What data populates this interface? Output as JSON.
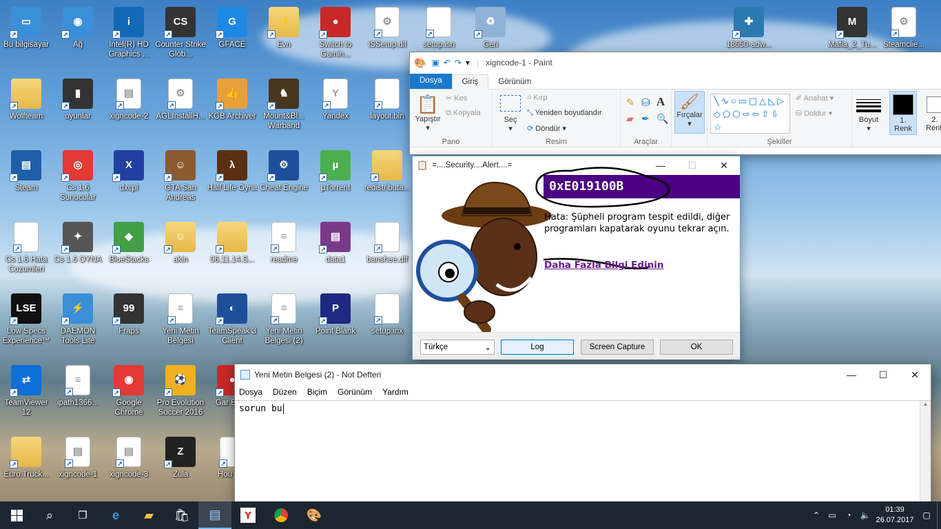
{
  "desktop": {
    "icons": [
      {
        "label": "Bu bilgisayar",
        "color": "#3a8fd8",
        "glyph": "▭"
      },
      {
        "label": "Ağ",
        "color": "#3a8fd8",
        "glyph": "◉"
      },
      {
        "label": "Intel(R) HD Graphics ...",
        "color": "#1468b8",
        "glyph": "i"
      },
      {
        "label": "Counter Strike Glob...",
        "color": "#333333",
        "glyph": "CS"
      },
      {
        "label": "GFACE",
        "color": "#1e88e5",
        "glyph": "G"
      },
      {
        "label": "Evn",
        "color": "#e7b84a",
        "glyph": "⚡"
      },
      {
        "label": "Switch to Gamin...",
        "color": "#c62828",
        "glyph": "●"
      },
      {
        "label": "ISSetup.dll",
        "color": "#dddddd",
        "glyph": "⚙"
      },
      {
        "label": "setup.isn",
        "color": "#ffffff",
        "glyph": ""
      },
      {
        "label": "Geri",
        "color": "#8fb3d6",
        "glyph": "♻"
      },
      {
        "label": "Wolfteam",
        "color": "#e7b84a",
        "glyph": ""
      },
      {
        "label": "oyunlar",
        "color": "#333333",
        "glyph": "▮"
      },
      {
        "label": "xigncode-2",
        "color": "#ffffff",
        "glyph": "▤"
      },
      {
        "label": "AGLInstallH...",
        "color": "#dddddd",
        "glyph": "⚙"
      },
      {
        "label": "KGB Archiver",
        "color": "#e8a03a",
        "glyph": "👍"
      },
      {
        "label": "Mount&Bl... Warband",
        "color": "#4a3520",
        "glyph": "♞"
      },
      {
        "label": "Yandex",
        "color": "#ffffff",
        "glyph": "Y"
      },
      {
        "label": "layout.bin",
        "color": "#ffffff",
        "glyph": ""
      },
      {
        "label": "Steam",
        "color": "#1e5fa8",
        "glyph": "▤"
      },
      {
        "label": "Cs 1.6 Sunucular",
        "color": "#e53935",
        "glyph": "◎"
      },
      {
        "label": "dxcpl",
        "color": "#2340a0",
        "glyph": "X"
      },
      {
        "label": "GTA San Andreas",
        "color": "#8a5a30",
        "glyph": "☺"
      },
      {
        "label": "Half Life Oyna",
        "color": "#5a3010",
        "glyph": "λ"
      },
      {
        "label": "Cheat Engine",
        "color": "#1e4f9a",
        "glyph": "⚙"
      },
      {
        "label": "µTorrent",
        "color": "#4caf50",
        "glyph": "µ"
      },
      {
        "label": "redistributa...",
        "color": "#e7b84a",
        "glyph": ""
      },
      {
        "label": "Cs 1.6 Hata Cozumleri",
        "color": "#ffffff",
        "glyph": ""
      },
      {
        "label": "Cs 1.6 OYNA",
        "color": "#555555",
        "glyph": "✦"
      },
      {
        "label": "BlueStacks",
        "color": "#43a047",
        "glyph": "◆"
      },
      {
        "label": "akin",
        "color": "#e7b84a",
        "glyph": "☺"
      },
      {
        "label": "06.11.14.S...",
        "color": "#e7b84a",
        "glyph": ""
      },
      {
        "label": "readme",
        "color": "#ffffff",
        "glyph": "≡"
      },
      {
        "label": "data1",
        "color": "#7a3a8a",
        "glyph": "▤"
      },
      {
        "label": "banshee.dff",
        "color": "#ffffff",
        "glyph": ""
      },
      {
        "label": "Low Specs Experience™",
        "color": "#111111",
        "glyph": "LSE"
      },
      {
        "label": "DAEMON Tools Lite",
        "color": "#3a8fd8",
        "glyph": "⚡"
      },
      {
        "label": "Fraps",
        "color": "#333333",
        "glyph": "99"
      },
      {
        "label": "Yeni Metin Belgesi",
        "color": "#ffffff",
        "glyph": "≡"
      },
      {
        "label": "TeamSpeak 3 Client",
        "color": "#1e4f9a",
        "glyph": "◐"
      },
      {
        "label": "Yeni Metin Belgesi (2)",
        "color": "#ffffff",
        "glyph": "≡"
      },
      {
        "label": "Point Blank",
        "color": "#1e2a80",
        "glyph": "P"
      },
      {
        "label": "setup.inx",
        "color": "#ffffff",
        "glyph": ""
      },
      {
        "label": "TeamViewer 12",
        "color": "#0e6fd6",
        "glyph": "⇄"
      },
      {
        "label": "ipath1366...",
        "color": "#ffffff",
        "glyph": "≡"
      },
      {
        "label": "Google Chrome",
        "color": "#e53935",
        "glyph": "◉"
      },
      {
        "label": "Pro Evolution Soccer 2016",
        "color": "#f0b020",
        "glyph": "⚽"
      },
      {
        "label": "Gar Boos",
        "color": "#c62828",
        "glyph": "●"
      },
      {
        "label": "Euro.Truck...",
        "color": "#e7b84a",
        "glyph": ""
      },
      {
        "label": "xigncode-1",
        "color": "#ffffff",
        "glyph": "▤"
      },
      {
        "label": "xigncode-3",
        "color": "#ffffff",
        "glyph": "▤"
      },
      {
        "label": "Zula",
        "color": "#222222",
        "glyph": "Z"
      },
      {
        "label": "Hou Onl",
        "color": "#ffffff",
        "glyph": ""
      },
      {
        "label": "18650-adw...",
        "color": "#2a7ab0",
        "glyph": "✚"
      },
      {
        "label": "Mafia_2_Tu...",
        "color": "#333333",
        "glyph": "M"
      },
      {
        "label": "Steamclie...",
        "color": "#dddddd",
        "glyph": "⚙"
      }
    ]
  },
  "paint": {
    "title": "xigncode-1 - Paint",
    "tabs": {
      "file": "Dosya",
      "home": "Giriş",
      "view": "Görünüm"
    },
    "clipboard": {
      "paste": "Yapıştır",
      "cut": "Kes",
      "copy": "Kopyala",
      "group": "Pano"
    },
    "image": {
      "select": "Seç",
      "crop": "Kırp",
      "resize": "Yeniden boyutlandır",
      "rotate": "Döndür",
      "group": "Resim"
    },
    "tools": {
      "group": "Araçlar"
    },
    "brushes": {
      "label": "Fırçalar"
    },
    "shapes": {
      "outline": "Anahat",
      "fill": "Doldur",
      "group": "Şekiller"
    },
    "size": {
      "label": "Boyut"
    },
    "color1": {
      "label": "1. Renk"
    },
    "color2": {
      "label": "2. Renk"
    }
  },
  "security": {
    "title": "=....Security....Alert....=",
    "code": "0xE019100B",
    "message": "Hata: Şüpheli program tespit edildi, diğer programları kapatarak oyunu tekrar açın.",
    "link": "Daha Fazla Bilgi Edinin",
    "language": "Türkçe",
    "buttons": {
      "log": "Log",
      "capture": "Screen Capture",
      "ok": "OK"
    },
    "accent": "#4b0082"
  },
  "notepad": {
    "title": "Yeni Metin Belgesi (2) - Not Defteri",
    "menu": [
      "Dosya",
      "Düzen",
      "Biçim",
      "Görünüm",
      "Yardım"
    ],
    "content": "sorun bu"
  },
  "taskbar": {
    "time": "01:39",
    "date": "26.07.2017"
  }
}
